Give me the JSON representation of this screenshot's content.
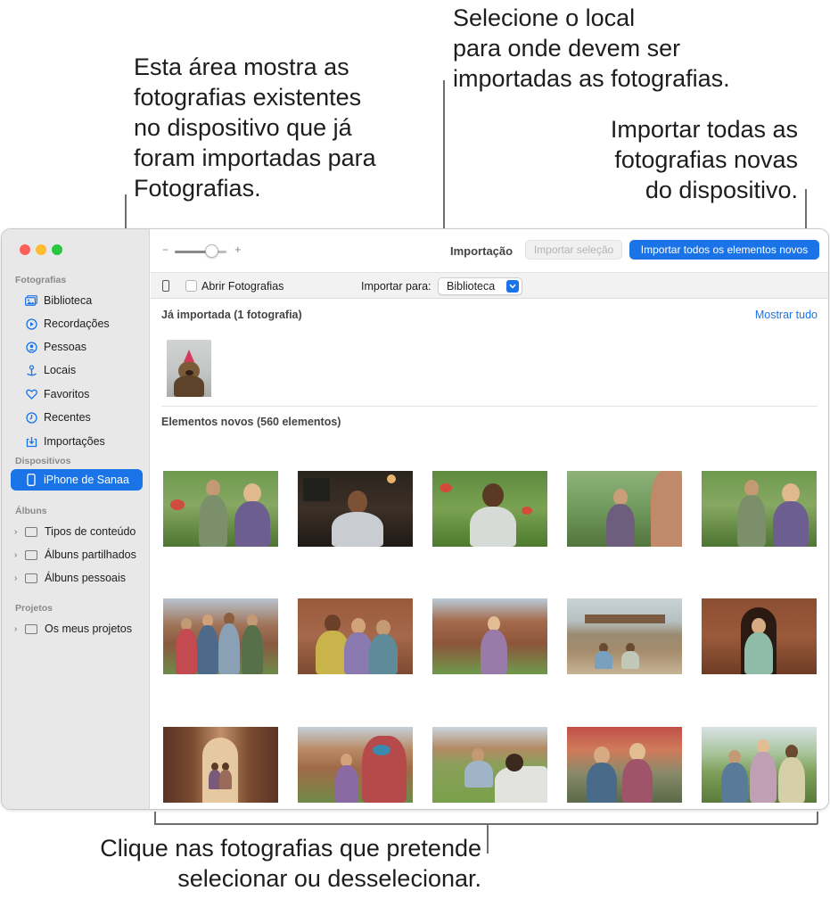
{
  "callouts": {
    "existing": "Esta área mostra as\nfotografias existentes\nno dispositivo que já\nforam importadas para\nFotografias.",
    "select_location": "Selecione o local\npara onde devem ser\nimportadas as fotografias.",
    "import_all": "Importar todas as\nfotografias novas\ndo dispositivo.",
    "click_photos": "Clique nas fotografias que pretende\nselecionar ou desselecionar."
  },
  "sidebar": {
    "sections": {
      "photos": "Fotografias",
      "devices": "Dispositivos",
      "albums": "Álbuns",
      "projects": "Projetos"
    },
    "photos_items": [
      {
        "label": "Biblioteca",
        "icon": "library-icon"
      },
      {
        "label": "Recordações",
        "icon": "memories-icon"
      },
      {
        "label": "Pessoas",
        "icon": "people-icon"
      },
      {
        "label": "Locais",
        "icon": "places-icon"
      },
      {
        "label": "Favoritos",
        "icon": "heart-icon"
      },
      {
        "label": "Recentes",
        "icon": "clock-icon"
      },
      {
        "label": "Importações",
        "icon": "imports-icon"
      }
    ],
    "device": {
      "label": "iPhone de Sanaa",
      "icon": "iphone-icon"
    },
    "album_items": [
      {
        "label": "Tipos de conteúdo"
      },
      {
        "label": "Álbuns partilhados"
      },
      {
        "label": "Álbuns pessoais"
      }
    ],
    "project_items": [
      {
        "label": "Os meus projetos"
      }
    ]
  },
  "toolbar": {
    "zoom_minus": "−",
    "zoom_plus": "+",
    "zoom_level": 0.7,
    "title": "Importação",
    "import_selection_label": "Importar seleção",
    "import_all_label": "Importar todos os elementos novos"
  },
  "options": {
    "open_photos_label": "Abrir Fotografias",
    "open_photos_checked": false,
    "import_to_label": "Importar para:",
    "import_to_value": "Biblioteca"
  },
  "content": {
    "already_imported_title": "Já importada (1 fotografia)",
    "show_all_label": "Mostrar tudo",
    "new_items_title": "Elementos novos (560 elementos)"
  },
  "colors": {
    "accent": "#1a74e8",
    "sidebar_bg": "#e8e8e8",
    "traffic_red": "#ff5f57",
    "traffic_yellow": "#febc2e",
    "traffic_green": "#28c840"
  }
}
